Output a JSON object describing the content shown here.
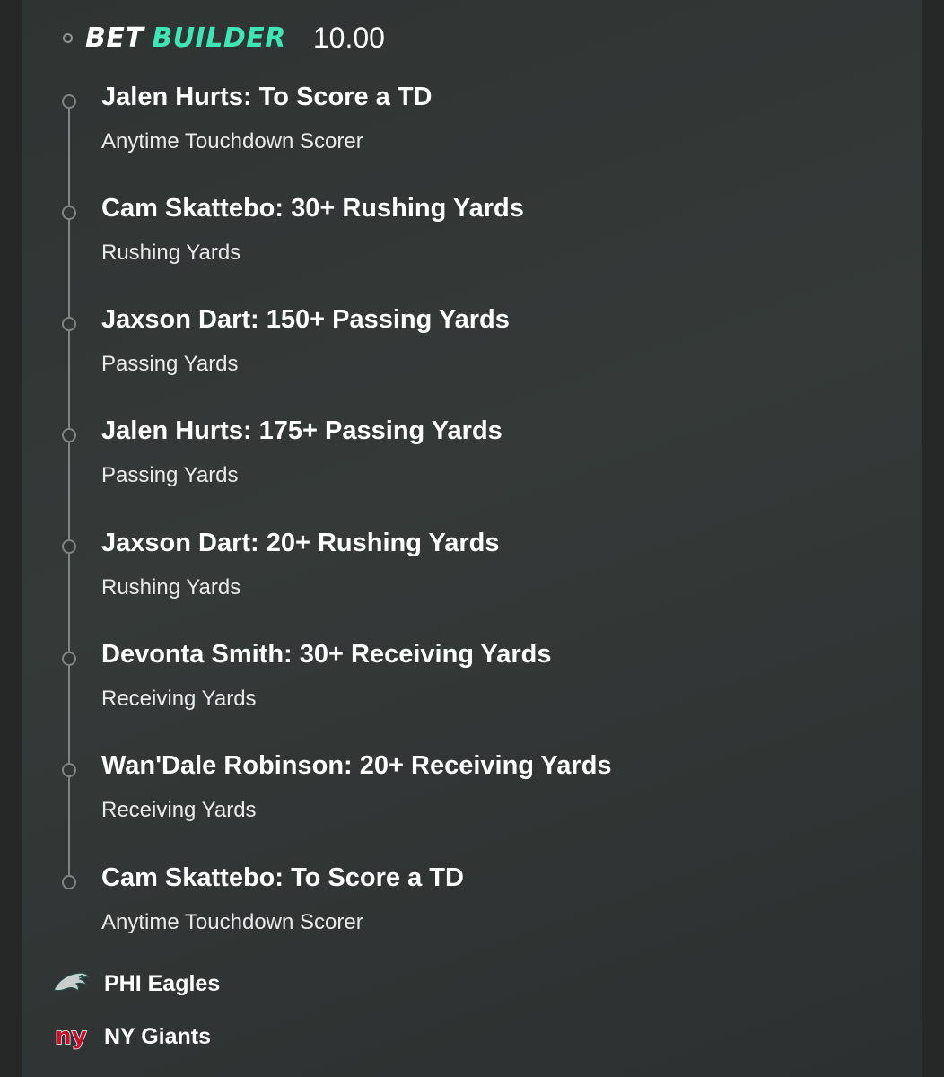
{
  "header": {
    "brand_bet": "BET",
    "brand_builder": "BUILDER",
    "odds": "10.00"
  },
  "legs": [
    {
      "title": "Jalen Hurts: To Score a TD",
      "market": "Anytime Touchdown Scorer"
    },
    {
      "title": "Cam Skattebo: 30+ Rushing Yards",
      "market": "Rushing Yards"
    },
    {
      "title": "Jaxson Dart: 150+ Passing Yards",
      "market": "Passing Yards"
    },
    {
      "title": "Jalen Hurts: 175+ Passing Yards",
      "market": "Passing Yards"
    },
    {
      "title": "Jaxson Dart: 20+ Rushing Yards",
      "market": "Rushing Yards"
    },
    {
      "title": "Devonta Smith: 30+ Receiving Yards",
      "market": "Receiving Yards"
    },
    {
      "title": "Wan'Dale Robinson: 20+ Receiving Yards",
      "market": "Receiving Yards"
    },
    {
      "title": "Cam Skattebo: To Score a TD",
      "market": "Anytime Touchdown Scorer"
    }
  ],
  "teams": [
    {
      "name": "PHI Eagles",
      "icon": "eagles-logo-icon"
    },
    {
      "name": "NY Giants",
      "icon": "giants-logo-icon"
    }
  ],
  "colors": {
    "accent": "#3ee6b5",
    "background": "#323635",
    "text": "#ffffff",
    "timeline": "#7f8583",
    "giants_red": "#c8102e"
  }
}
